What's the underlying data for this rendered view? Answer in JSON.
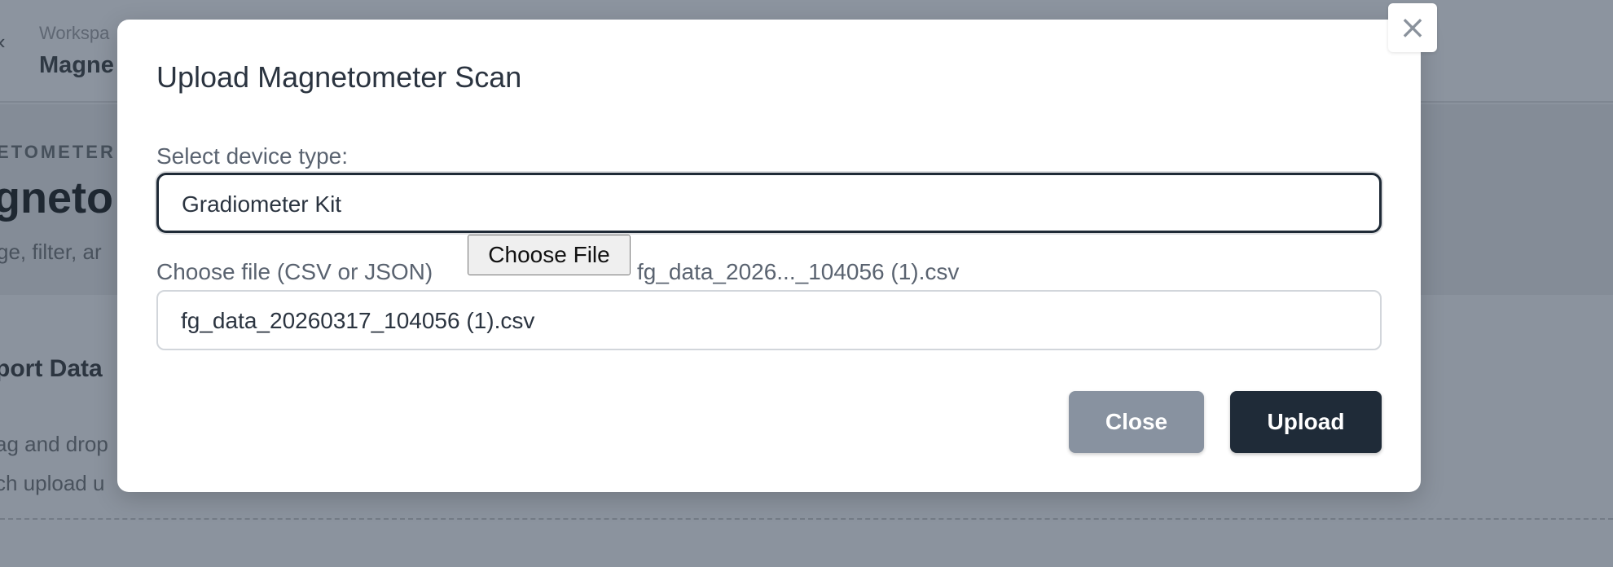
{
  "background": {
    "back_glyph": "‹",
    "breadcrumb_small": "Workspa",
    "breadcrumb_title": "Magne",
    "eyebrow": "ETOMETER",
    "hero_title": "gneto",
    "hero_subtitle": "ge, filter, ar",
    "section_title": "port Data",
    "body_line_1": "ag and drop",
    "body_line_2": "ch upload u"
  },
  "modal": {
    "close_x": "×",
    "title": "Upload Magnetometer Scan",
    "device_label": "Select device type:",
    "device_selected": "Gradiometer Kit",
    "file_label": "Choose file (CSV or JSON)",
    "choose_file_button": "Choose File",
    "chosen_file_name": "fg_data_2026..._104056 (1).csv",
    "filename_value": "fg_data_20260317_104056 (1).csv",
    "close_button": "Close",
    "upload_button": "Upload"
  },
  "colors": {
    "overlay": "#8b939e",
    "primary": "#1f2b38",
    "secondary": "#8892a0",
    "modal_bg": "#ffffff"
  }
}
